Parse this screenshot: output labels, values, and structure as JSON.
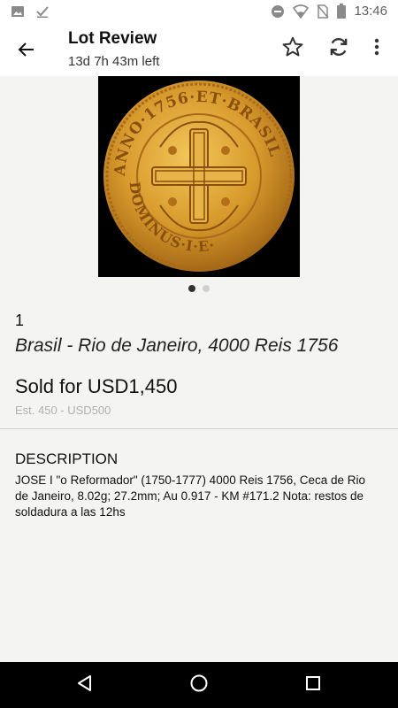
{
  "status_bar": {
    "time": "13:46",
    "left_icons": [
      "image-icon",
      "check-icon"
    ],
    "right_icons": [
      "do-not-disturb-icon",
      "wifi-icon",
      "no-sim-icon",
      "battery-icon"
    ]
  },
  "app_bar": {
    "title": "Lot Review",
    "subtitle": "13d 7h 43m left",
    "icons": [
      "back-arrow-icon",
      "star-outline-icon",
      "refresh-icon",
      "more-vert-icon"
    ]
  },
  "lot": {
    "image_description": "gold coin",
    "image_count": 2,
    "active_image": 1,
    "coin_legend_top": "ANNO·1756·ET·BRASIL",
    "coin_legend_bottom": "DOMINUS·I·E·",
    "number": "1",
    "title": "Brasil - Rio de Janeiro, 4000 Reis 1756",
    "sold": "Sold for USD1,450",
    "estimate": "Est. 450 - USD500"
  },
  "description": {
    "heading": "DESCRIPTION",
    "body": "JOSE I \"o Reformador\" (1750-1777) 4000 Reis 1756, Ceca de Rio de Janeiro, 8.02g; 27.2mm; Au 0.917 - KM #171.2 Nota: restos de soldadura a las 12hs"
  },
  "nav_bar": {
    "icons": [
      "nav-back-icon",
      "nav-home-icon",
      "nav-recents-icon"
    ]
  }
}
